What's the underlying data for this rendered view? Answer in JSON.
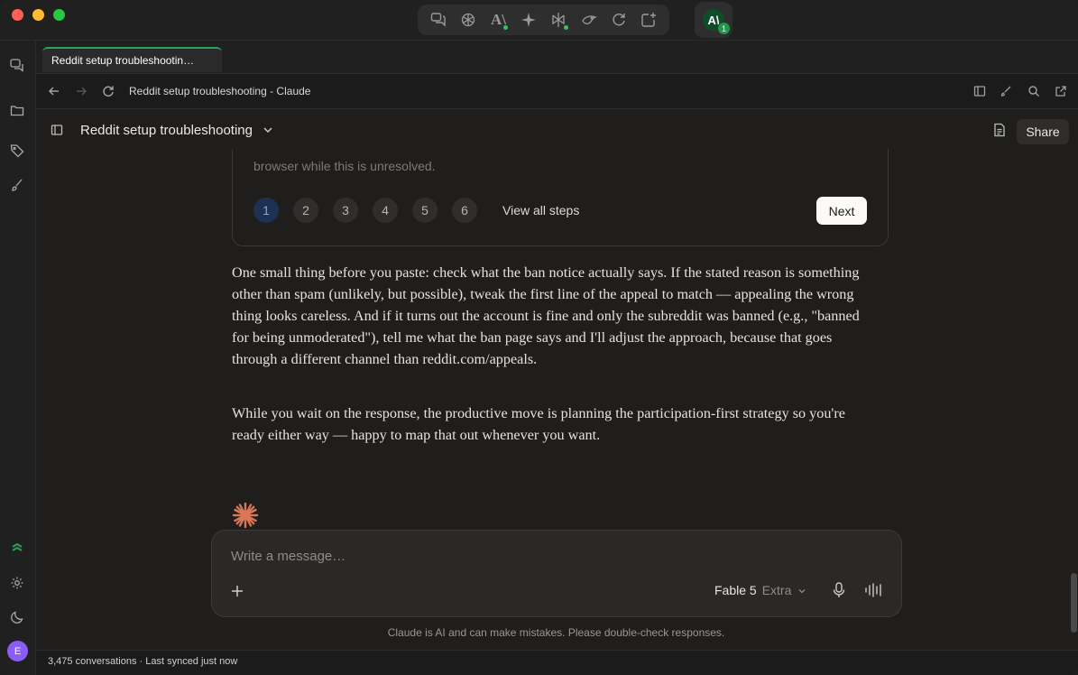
{
  "app": {
    "switcher_icons": [
      "chat-bubbles-icon",
      "openai-icon",
      "ai-text-icon",
      "sparkle-icon",
      "perplexity-icon",
      "bird-icon",
      "refresh-circle-icon",
      "new-chat-icon"
    ],
    "active_app_label": "A\\",
    "active_app_count": "1"
  },
  "rail": {
    "avatar_initial": "E"
  },
  "tab": {
    "label": "Reddit setup troubleshootin…"
  },
  "navbar": {
    "page_title": "Reddit setup troubleshooting - Claude"
  },
  "header": {
    "conversation_title": "Reddit setup troubleshooting",
    "share_label": "Share"
  },
  "steps_card": {
    "faded_text": "browser while this is unresolved.",
    "steps": [
      "1",
      "2",
      "3",
      "4",
      "5",
      "6"
    ],
    "active_step": "1",
    "view_all_label": "View all steps",
    "next_label": "Next"
  },
  "message": {
    "paragraph_1": "One small thing before you paste: check what the ban notice actually says. If the stated reason is something other than spam (unlikely, but possible), tweak the first line of the appeal to match — appealing the wrong thing looks careless. And if it turns out the account is fine and only the subreddit was banned (e.g., \"banned for being unmoderated\"), tell me what the ban page says and I'll adjust the approach, because that goes through a different channel than reddit.com/appeals.",
    "paragraph_2": "While you wait on the response, the productive move is planning the participation-first strategy so you're ready either way — happy to map that out whenever you want."
  },
  "composer": {
    "placeholder": "Write a message…",
    "model_name": "Fable 5",
    "model_mode": "Extra"
  },
  "disclaimer": "Claude is AI and can make mistakes. Please double-check responses.",
  "status": {
    "text": "3,475 conversations · Last synced just now"
  },
  "colors": {
    "accent_green": "#2fa15a",
    "claude_orange": "#d97757",
    "active_step_bg": "#1d3153",
    "avatar_purple": "#8b5cf6"
  }
}
